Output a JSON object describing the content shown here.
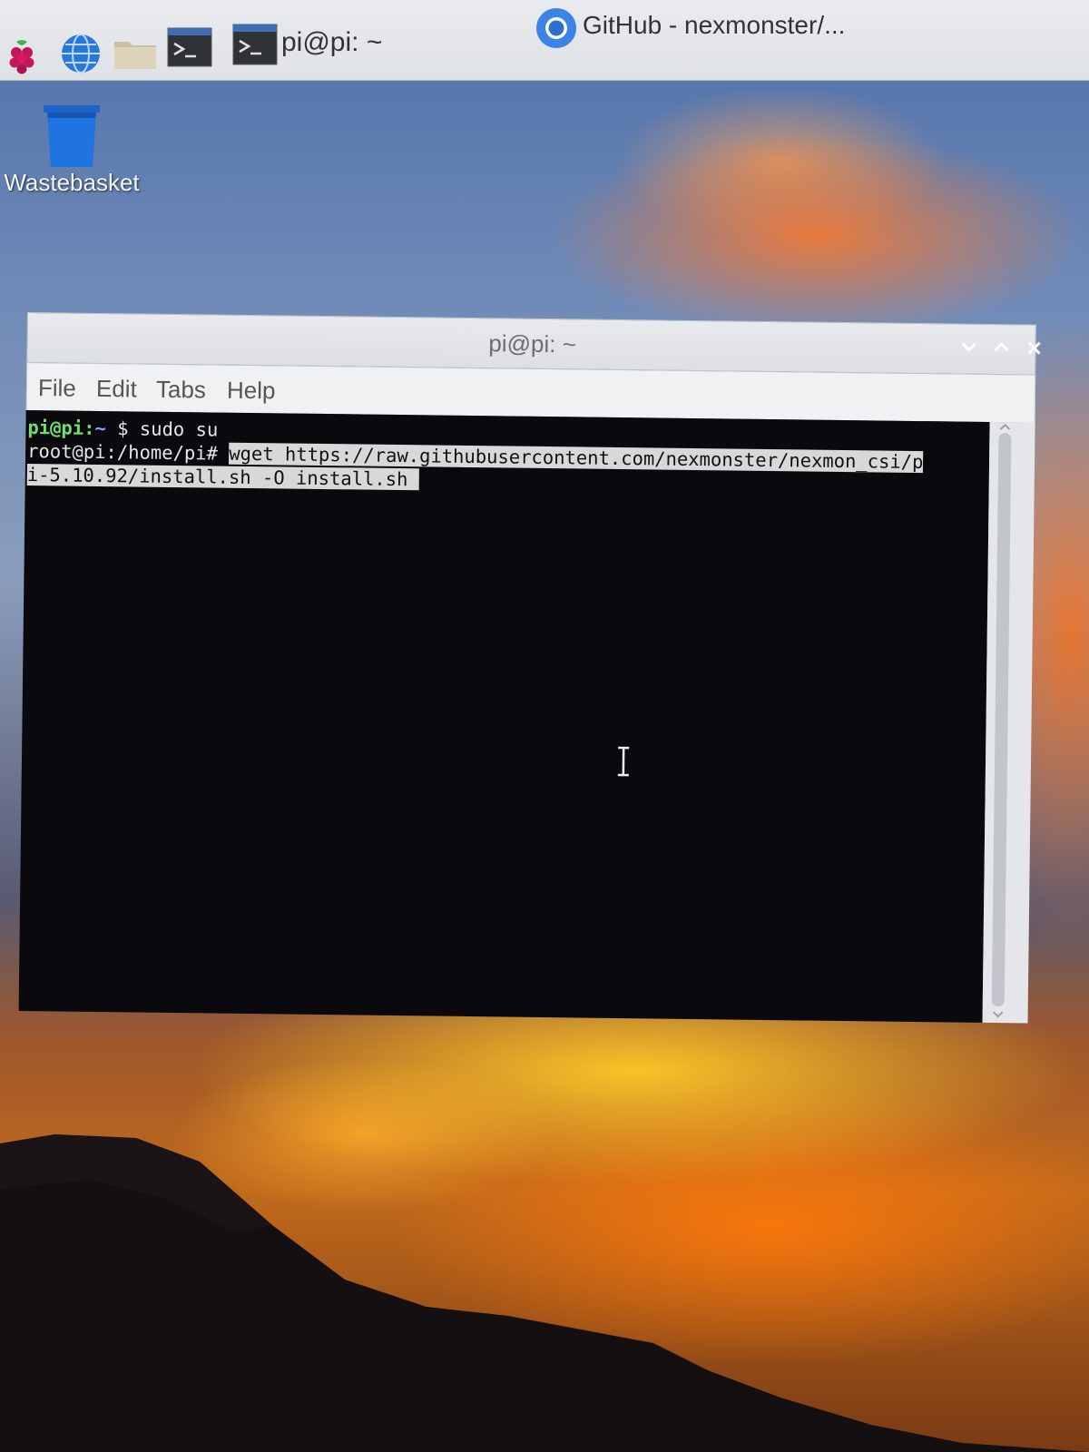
{
  "taskbar": {
    "terminal_task_label": "pi@pi: ~",
    "browser_task_label": "GitHub - nexmonster/..."
  },
  "desktop": {
    "wastebasket_label": "Wastebasket"
  },
  "terminal": {
    "title": "pi@pi: ~",
    "menu": {
      "file": "File",
      "edit": "Edit",
      "tabs": "Tabs",
      "help": "Help"
    },
    "lines": {
      "line1_user": "pi@pi",
      "line1_colon": ":",
      "line1_path": "~",
      "line1_rest": " $ sudo su",
      "line2_prompt": "root@pi:/home/pi# ",
      "line2_selected": "wget https://raw.githubusercontent.com/nexmonster/nexmon_csi/p",
      "line3_selected": "i-5.10.92/install.sh -O install.sh "
    }
  },
  "colors": {
    "prompt_user": "#6ee06e",
    "prompt_path": "#7ea8ff",
    "terminal_bg": "#0a0a0e",
    "selection_bg": "#d8d8d8"
  },
  "icons": [
    "raspberry-icon",
    "globe-icon",
    "folder-icon",
    "terminal-icon",
    "chromium-icon",
    "trash-icon",
    "chevron-down-icon",
    "chevron-up-icon",
    "close-icon",
    "text-cursor-icon"
  ]
}
